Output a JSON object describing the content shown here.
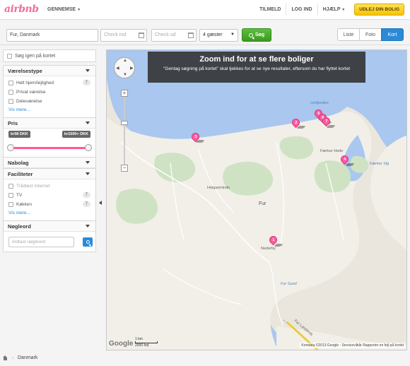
{
  "header": {
    "logo": "airbnb",
    "browse_label": "GENNEMSE",
    "signup": "TILMELD",
    "login": "LOG IND",
    "help": "HJÆLP",
    "host_button": "UDLEJ DIN BOLIG"
  },
  "search": {
    "location": "Fur, Danmark",
    "checkin_placeholder": "Check ind",
    "checkout_placeholder": "Check ud",
    "guests": "4 gæster",
    "search_button": "Søg",
    "view_tabs": [
      "Liste",
      "Foto",
      "Kort"
    ],
    "active_view": "Kort"
  },
  "sidebar": {
    "map_search_label": "Søg igen på kortet",
    "room_type": {
      "title": "Værelsestype",
      "options": [
        {
          "label": "Helt hjem/lejlighed",
          "count": "7"
        },
        {
          "label": "Privat værelse",
          "count": ""
        },
        {
          "label": "Deleværelse",
          "count": ""
        }
      ],
      "more": "Vis mere..."
    },
    "price": {
      "title": "Pris",
      "min_label": "kr58 DKK",
      "max_label": "kr1500+ DKK"
    },
    "neighborhood": {
      "title": "Nabolag"
    },
    "amenities": {
      "title": "Faciliteter",
      "options": [
        {
          "label": "Trådløst Internet",
          "count": ""
        },
        {
          "label": "TV",
          "count": "7"
        },
        {
          "label": "Køkken",
          "count": "7"
        }
      ],
      "more": "Vis mere..."
    },
    "keyword": {
      "title": "Nøgleord",
      "placeholder": "Indtast nøgleord"
    }
  },
  "map": {
    "banner_title": "Zoom ind for at se flere boliger",
    "banner_subtitle": "\"Gentag søgning på kortet\" skal tjekkes for at se nye resultater, eftersom du har flyttet kortet",
    "labels": {
      "limfjorden": "Limfjorden",
      "faerker_hede": "Færker Hede",
      "faerker_vig": "Færker Vig",
      "helgasminde": "Helgasminde",
      "fur": "Fur",
      "nederby": "Nederby",
      "fur_sund": "Fur Sund",
      "fur_landevej": "Fur Landevej"
    },
    "pins": [
      "1",
      "2",
      "3",
      "4",
      "5",
      "6",
      "7"
    ],
    "google": "Google",
    "scale_km": "1 km",
    "scale_ft": "2000 fod",
    "attribution": "Kortdata ©2013 Google - Servicevilkår   Rapporter en fejl på kortet"
  },
  "breadcrumb": {
    "country": "Danmark"
  }
}
